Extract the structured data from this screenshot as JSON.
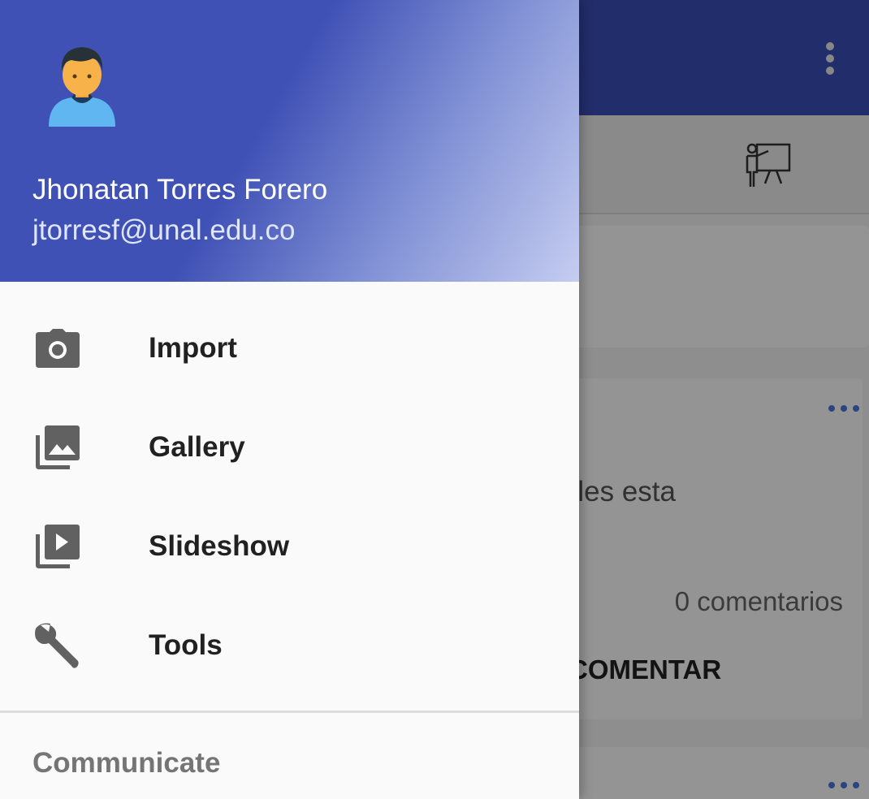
{
  "drawer": {
    "user_name": "Jhonatan Torres Forero",
    "user_email": "jtorresf@unal.edu.co",
    "avatar_icon": "person-avatar-icon",
    "header_color": "#3f51b5",
    "items": [
      {
        "label": "Import",
        "icon": "camera-icon"
      },
      {
        "label": "Gallery",
        "icon": "photo-library-icon"
      },
      {
        "label": "Slideshow",
        "icon": "slideshow-icon"
      },
      {
        "label": "Tools",
        "icon": "wrench-icon"
      }
    ],
    "section_header": "Communicate"
  },
  "background": {
    "post_text_fragment": "artirles esta",
    "comments_count": "0 comentarios",
    "comment_button": "COMENTAR",
    "app_bar_color": "#3b4fb8",
    "accent_color": "#4a79d9"
  }
}
